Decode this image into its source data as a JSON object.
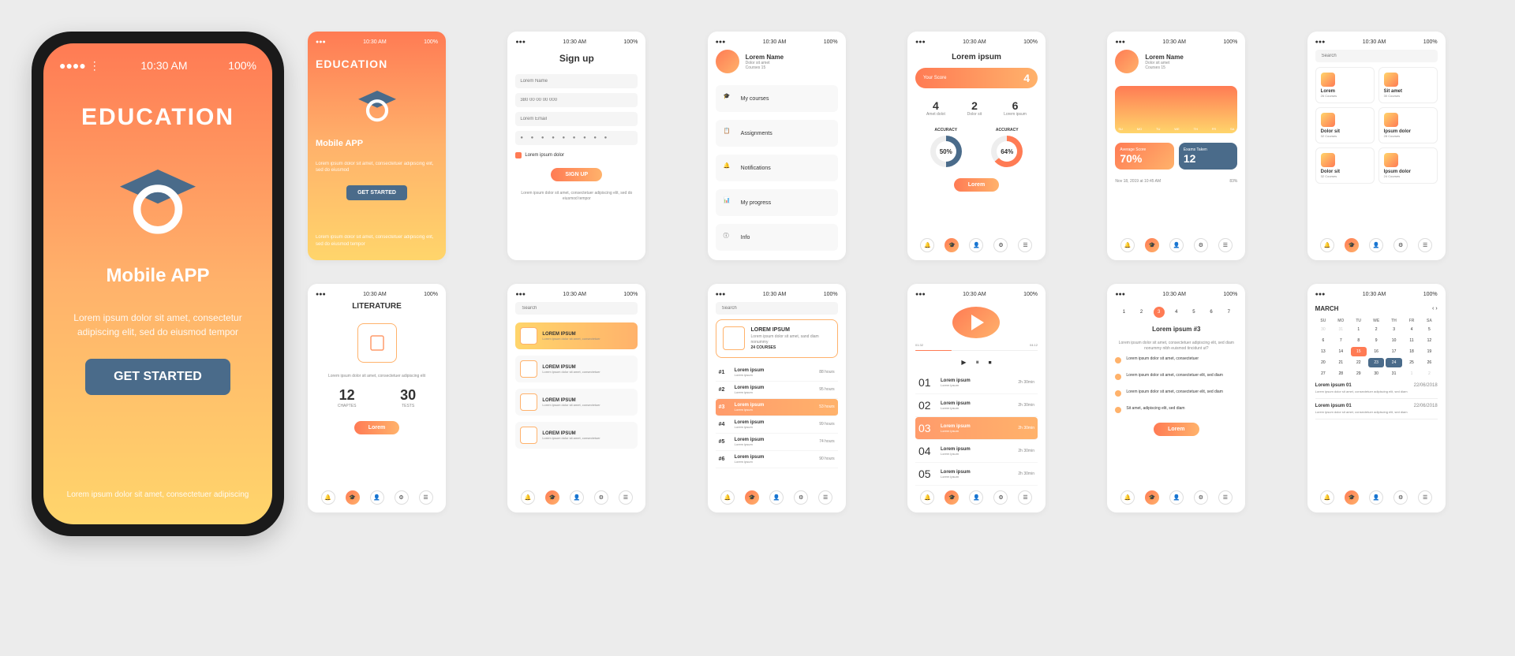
{
  "status": {
    "time": "10:30 AM",
    "battery": "100%"
  },
  "app": {
    "title": "EDUCATION",
    "subtitle": "Mobile APP",
    "desc": "Lorem ipsum dolor sit amet, consectetur adipiscing elit, sed do eiusmod tempor",
    "cta": "GET STARTED",
    "footer": "Lorem ipsum dolor sit amet, consectetuer adipiscing"
  },
  "splash": {
    "title": "EDUCATION",
    "subtitle": "Mobile APP",
    "desc": "Lorem ipsum dolor sit amet, consectetuer adipiscing elit, sed do eiusmod",
    "cta": "GET STARTED",
    "footer": "Lorem ipsum dolor sit amet, consectetuer adipiscing elit, sed do eiusmod tempor"
  },
  "signup": {
    "title": "Sign up",
    "name": "Lorem Name",
    "phone": "380 00 00 00 000",
    "email": "Lorem Email",
    "check": "Lorem ipsum dolor",
    "btn": "SIGN UP",
    "terms": "Lorem ipsum dolor sit amet, consectetuer adipiscing elit, sed do eiusmod tempor"
  },
  "profile": {
    "name": "Lorem Name",
    "sub1": "Dolor sit amet",
    "sub2": "Courses 15",
    "menu": [
      "My courses",
      "Assignments",
      "Notifications",
      "My progress",
      "Info"
    ]
  },
  "score": {
    "title": "Lorem ipsum",
    "pill_label": "Your Score",
    "pill_val": "4",
    "cols": [
      {
        "n": "4",
        "l": "Amet dolot"
      },
      {
        "n": "2",
        "l": "Dolor sit"
      },
      {
        "n": "6",
        "l": "Lorem ipsum"
      }
    ],
    "acc": "ACCURACY",
    "d1": "50%",
    "d2": "64%",
    "btn": "Lorem"
  },
  "dashboard": {
    "name": "Lorem Name",
    "sub1": "Dolor sit amet",
    "sub2": "Courses 15",
    "days": [
      "SU",
      "MO",
      "TU",
      "WE",
      "TH",
      "FR",
      "SA"
    ],
    "card1_l": "Average Score",
    "card1_v": "70%",
    "card2_l": "Exams Taken",
    "card2_v": "12",
    "date": "Nov 18, 2019 at 10:45 AM",
    "pct": "83%"
  },
  "categories": {
    "search": "Search",
    "items": [
      {
        "n": "Lorem",
        "s": "26 Courses"
      },
      {
        "n": "Sit amet",
        "s": "30 Courses"
      },
      {
        "n": "Dolor sit",
        "s": "32 Courses"
      },
      {
        "n": "Ipsum dolor",
        "s": "28 Courses"
      },
      {
        "n": "Dolor sit",
        "s": "32 Courses"
      },
      {
        "n": "Ipsum dolor",
        "s": "24 Courses"
      }
    ]
  },
  "literature": {
    "title": "LITERATURE",
    "desc": "Lorem ipsum dolor sit amet, consectetuer adipiscing elit",
    "n1": "12",
    "l1": "CHAPTES",
    "n2": "30",
    "l2": "TESTS",
    "btn": "Lorem"
  },
  "subjects": {
    "search": "Search",
    "items": [
      {
        "t": "LOREM IPSUM",
        "s": "Lorem ipsum dolor sit amet, consectetuer"
      },
      {
        "t": "LOREM IPSUM",
        "s": "Lorem ipsum dolor sit amet, consectetuer"
      },
      {
        "t": "LOREM IPSUM",
        "s": "Lorem ipsum dolor sit amet, consectetuer"
      },
      {
        "t": "LOREM IPSUM",
        "s": "Lorem ipsum dolor sit amet, consectetuer"
      }
    ]
  },
  "ranking": {
    "search": "Search",
    "header": {
      "t": "LOREM IPSUM",
      "s": "Lorem ipsum dolor sit amet, sand diam nonummy",
      "c": "24 COURSES"
    },
    "rows": [
      {
        "r": "#1",
        "t": "Lorem ipsum",
        "s": "Lorem ipsum",
        "v": "88 hours"
      },
      {
        "r": "#2",
        "t": "Lorem ipsum",
        "s": "Lorem ipsum",
        "v": "95 hours"
      },
      {
        "r": "#3",
        "t": "Lorem ipsum",
        "s": "Lorem ipsum",
        "v": "53 hours"
      },
      {
        "r": "#4",
        "t": "Lorem ipsum",
        "s": "Lorem ipsum",
        "v": "99 hours"
      },
      {
        "r": "#5",
        "t": "Lorem ipsum",
        "s": "Lorem ipsum",
        "v": "74 hours"
      },
      {
        "r": "#6",
        "t": "Lorem ipsum",
        "s": "Lorem ipsum",
        "v": "90 hours"
      }
    ]
  },
  "lessons": {
    "rows": [
      {
        "n": "01",
        "t": "Lorem ipsum",
        "s": "Lorem ipsum",
        "d": "2h 30min"
      },
      {
        "n": "02",
        "t": "Lorem ipsum",
        "s": "Lorem ipsum",
        "d": "2h 30min"
      },
      {
        "n": "03",
        "t": "Lorem ipsum",
        "s": "Lorem ipsum",
        "d": "2h 30min"
      },
      {
        "n": "04",
        "t": "Lorem ipsum",
        "s": "Lorem ipsum",
        "d": "2h 30min"
      },
      {
        "n": "05",
        "t": "Lorem ipsum",
        "s": "Lorem ipsum",
        "d": "2h 30min"
      }
    ]
  },
  "player": {
    "t1": "01:32",
    "t2": "04:12",
    "title": "Lorem ipsum #3",
    "desc": "Lorem ipsum dolor sit amet, consectetuer adipiscing elit, sed diam nonummy nibh euismod tincidunt ut?",
    "events": [
      "Lorem ipsum dolor sit amet, consectetuer",
      "Lorem ipsum dolor sit amet, consectetuer elit, sed diam",
      "Lorem ipsum dolor sit amet, consectetuer elit, sed diam",
      "Sit amet, adipiscing elit, sed diam"
    ],
    "btn": "Lorem"
  },
  "weekcal": {
    "days": [
      "1",
      "2",
      "3",
      "4",
      "5",
      "6",
      "7"
    ]
  },
  "monthcal": {
    "month": "MARCH",
    "heads": [
      "SU",
      "MO",
      "TU",
      "WE",
      "TH",
      "FR",
      "SA"
    ],
    "weeks": [
      [
        "30",
        "31",
        "1",
        "2",
        "3",
        "4",
        "5"
      ],
      [
        "6",
        "7",
        "8",
        "9",
        "10",
        "11",
        "12"
      ],
      [
        "13",
        "14",
        "15",
        "16",
        "17",
        "18",
        "19"
      ],
      [
        "20",
        "21",
        "22",
        "23",
        "24",
        "25",
        "26"
      ],
      [
        "27",
        "28",
        "29",
        "30",
        "31",
        "1",
        "2"
      ]
    ],
    "events": [
      {
        "t": "Lorem ipsum 01",
        "d": "22/06/2018",
        "s": "Lorem ipsum dolor sit amet, consectetuer adipiscing elit, sed diam"
      },
      {
        "t": "Lorem ipsum 01",
        "d": "22/06/2018",
        "s": "Lorem ipsum dolor sit amet, consectetuer adipiscing elit, sed diam"
      }
    ]
  }
}
